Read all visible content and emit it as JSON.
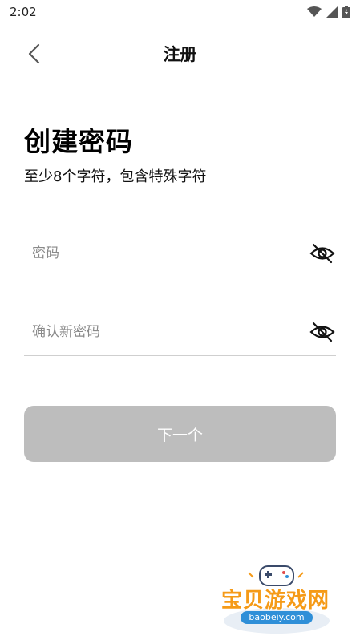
{
  "status_bar": {
    "time": "2:02"
  },
  "header": {
    "title": "注册"
  },
  "main": {
    "title": "创建密码",
    "subtitle": "至少8个字符，包含特殊字符",
    "password_field": {
      "placeholder": "密码",
      "value": ""
    },
    "confirm_field": {
      "placeholder": "确认新密码",
      "value": ""
    },
    "next_button": {
      "label": "下一个"
    }
  },
  "watermark": {
    "text": "宝贝游戏网",
    "url": "baobeiy.com"
  },
  "colors": {
    "button_disabled": "#bdbdbd",
    "divider": "#cfcfcf",
    "watermark_orange": "#f59a17",
    "watermark_blue": "#2f8fd8"
  }
}
